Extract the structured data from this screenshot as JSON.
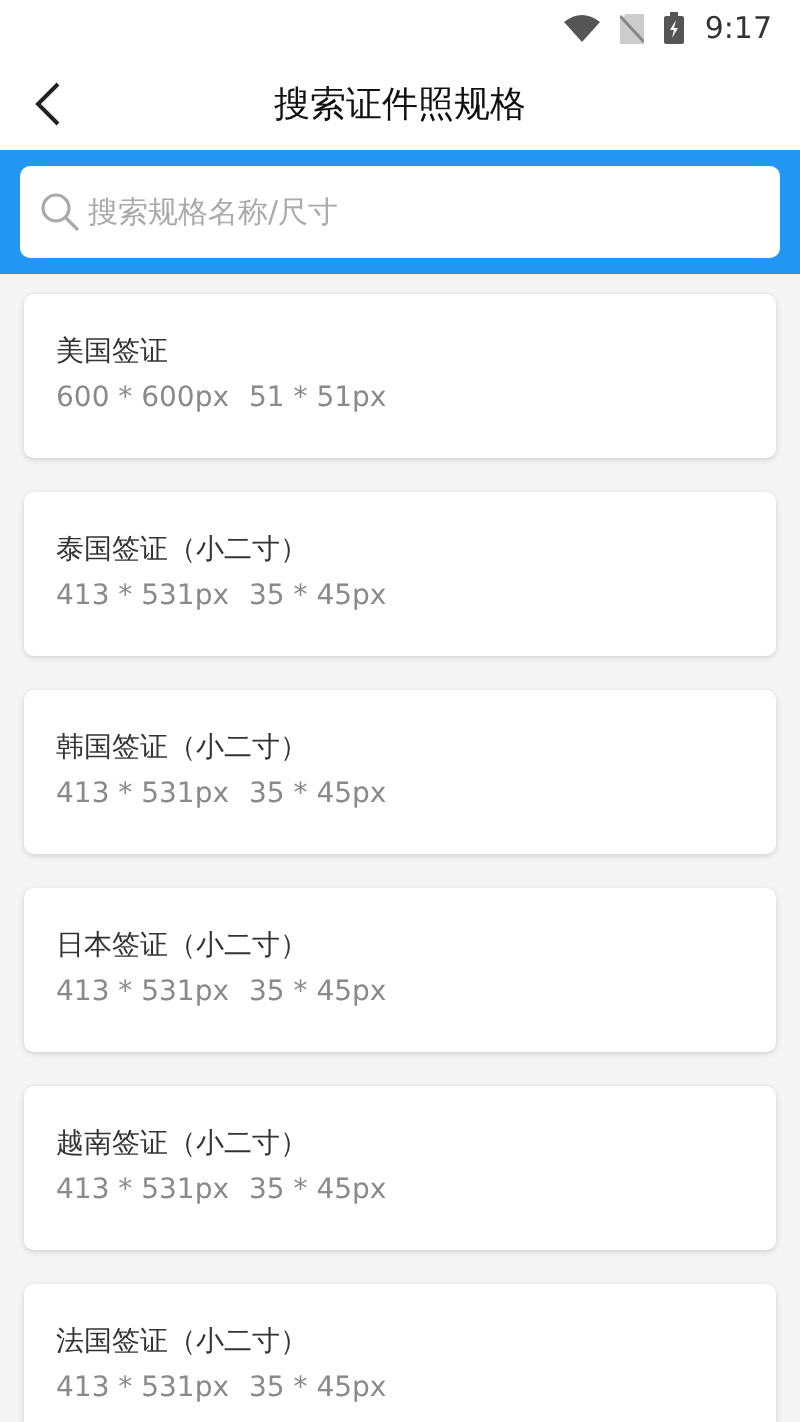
{
  "status_bar": {
    "time": "9:17"
  },
  "header": {
    "title": "搜索证件照规格"
  },
  "search": {
    "placeholder": "搜索规格名称/尺寸"
  },
  "specs": [
    {
      "name": "美国签证",
      "pixels": "600 * 600px",
      "size": "51 * 51px"
    },
    {
      "name": "泰国签证（小二寸）",
      "pixels": "413 * 531px",
      "size": "35 * 45px"
    },
    {
      "name": "韩国签证（小二寸）",
      "pixels": "413 * 531px",
      "size": "35 * 45px"
    },
    {
      "name": "日本签证（小二寸）",
      "pixels": "413 * 531px",
      "size": "35 * 45px"
    },
    {
      "name": "越南签证（小二寸）",
      "pixels": "413 * 531px",
      "size": "35 * 45px"
    },
    {
      "name": "法国签证（小二寸）",
      "pixels": "413 * 531px",
      "size": "35 * 45px"
    }
  ]
}
